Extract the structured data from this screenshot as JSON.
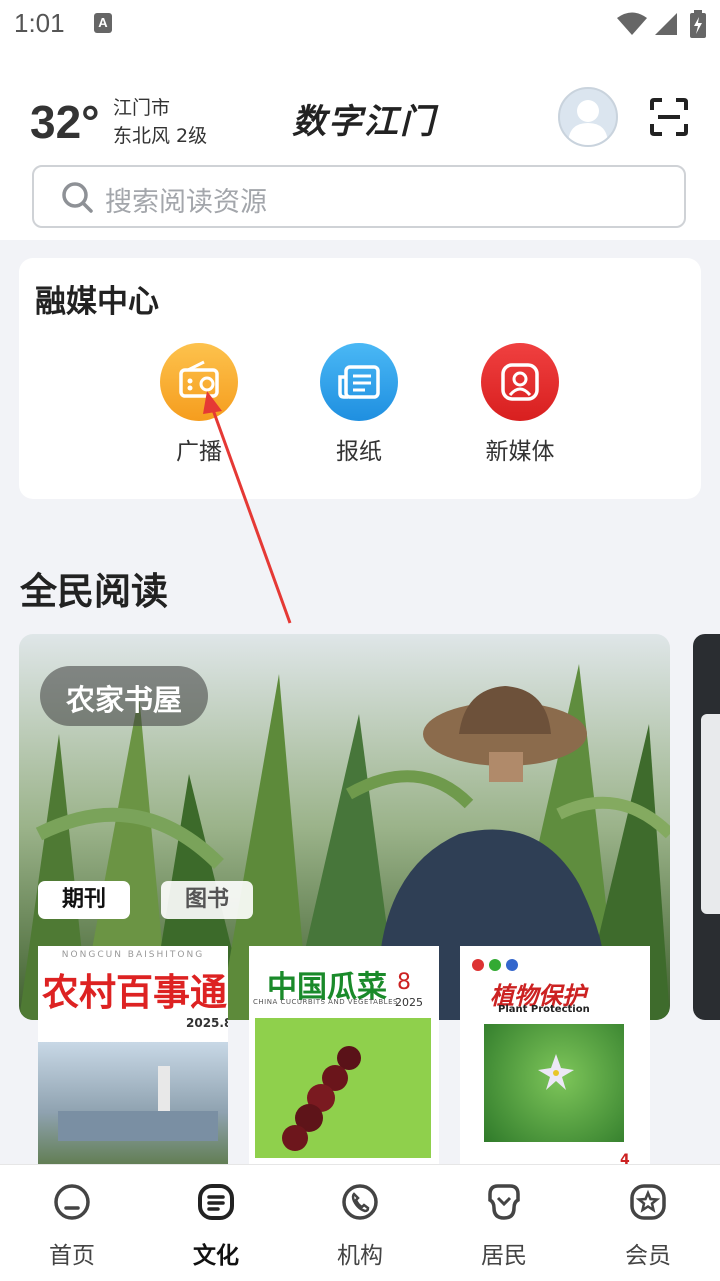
{
  "status": {
    "time": "1:01",
    "notif_letter": "A"
  },
  "weather": {
    "temperature": "32°",
    "city": "江门市",
    "wind": "东北风  2级"
  },
  "app": {
    "title": "数字江门"
  },
  "search": {
    "placeholder": "搜索阅读资源"
  },
  "media_center": {
    "title": "融媒中心",
    "items": [
      {
        "label": "广播",
        "icon": "radio-icon",
        "color": "#f5a623"
      },
      {
        "label": "报纸",
        "icon": "newspaper-icon",
        "color": "#2a9ee8"
      },
      {
        "label": "新媒体",
        "icon": "new-media-icon",
        "color": "#e02b2b"
      }
    ]
  },
  "reading": {
    "title": "全民阅读",
    "banner_label": "农家书屋",
    "tabs": [
      "期刊",
      "图书"
    ],
    "covers": [
      {
        "title": "农村百事通",
        "pinyin": "NONGCUN  BAISHITONG",
        "issue": "2025.8"
      },
      {
        "title": "中国瓜菜",
        "subtitle": "CHINA CUCURBITS AND VEGETABLES",
        "issue": "8",
        "year": "2025"
      },
      {
        "title": "植物保护",
        "subtitle": "Plant Protection",
        "issue": "4"
      }
    ]
  },
  "bottom_nav": [
    {
      "label": "首页",
      "icon": "home-icon"
    },
    {
      "label": "文化",
      "icon": "culture-icon"
    },
    {
      "label": "机构",
      "icon": "phone-icon"
    },
    {
      "label": "居民",
      "icon": "resident-icon"
    },
    {
      "label": "会员",
      "icon": "member-icon"
    }
  ],
  "colors": {
    "accent_arrow": "#e53935",
    "tab_selected_bg": "#ffffff"
  }
}
